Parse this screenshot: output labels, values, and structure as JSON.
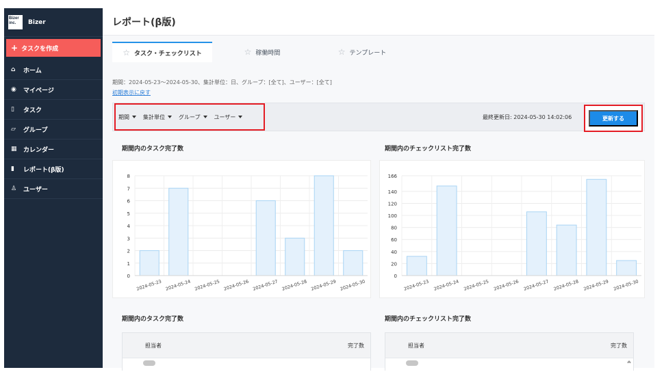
{
  "app": {
    "brand": {
      "logo_text": "Bizer inc.",
      "name": "Bizer"
    },
    "create_button": "タスクを作成",
    "sidebar": {
      "items": [
        {
          "label": "ホーム",
          "icon": "home-icon"
        },
        {
          "label": "マイページ",
          "icon": "person-circle-icon"
        },
        {
          "label": "タスク",
          "icon": "document-icon"
        },
        {
          "label": "グループ",
          "icon": "folder-icon"
        },
        {
          "label": "カレンダー",
          "icon": "calendar-icon"
        },
        {
          "label": "レポート(β版)",
          "icon": "bar-chart-icon"
        },
        {
          "label": "ユーザー",
          "icon": "user-icon"
        }
      ]
    }
  },
  "header": {
    "title": "レポート(β版)"
  },
  "tabs": [
    {
      "label": "タスク・チェックリスト",
      "active": true
    },
    {
      "label": "稼働時間",
      "active": false
    },
    {
      "label": "テンプレート",
      "active": false
    }
  ],
  "filters": {
    "summary": "期間：2024-05-23〜2024-05-30、集計単位：日、グループ：[全て]、ユーザー：[全て]",
    "reset_link": "初期表示に戻す",
    "items": [
      "期間",
      "集計単位",
      "グループ",
      "ユーザー"
    ],
    "last_updated": "最終更新日: 2024-05-30 14:02:06",
    "update_button": "更新する"
  },
  "chart_data": [
    {
      "type": "bar",
      "title": "期間内のタスク完了数",
      "categories": [
        "2024-05-23",
        "2024-05-24",
        "2024-05-25",
        "2024-05-26",
        "2024-05-27",
        "2024-05-28",
        "2024-05-29",
        "2024-05-30"
      ],
      "values": [
        2,
        7,
        0,
        0,
        6,
        3,
        8,
        2
      ],
      "yticks": [
        "0",
        "1",
        "2",
        "3",
        "4",
        "5",
        "6",
        "7",
        "8"
      ],
      "ylim": [
        0,
        8
      ],
      "grid": true
    },
    {
      "type": "bar",
      "title": "期間内のチェックリスト完了数",
      "categories": [
        "2024-05-23",
        "2024-05-24",
        "2024-05-25",
        "2024-05-26",
        "2024-05-27",
        "2024-05-28",
        "2024-05-29",
        "2024-05-30"
      ],
      "values": [
        32,
        149,
        0,
        0,
        106,
        84,
        160,
        25
      ],
      "yticks": [
        "0",
        "20",
        "40",
        "60",
        "80",
        "100",
        "120",
        "140",
        "166"
      ],
      "ylim": [
        0,
        166
      ],
      "grid": true
    }
  ],
  "tables": [
    {
      "title": "期間内のタスク完了数",
      "headers": {
        "assignee": "担当者",
        "completed": "完了数"
      }
    },
    {
      "title": "期間内のチェックリスト完了数",
      "headers": {
        "assignee": "担当者",
        "completed": "完了数"
      }
    }
  ],
  "colors": {
    "sidebar": "#1d2b3d",
    "create": "#f65d5a",
    "primary": "#1d8be8",
    "highlight": "#e41b23",
    "bar_fill": "#e4f1fc",
    "bar_stroke": "#a9d4f4"
  }
}
